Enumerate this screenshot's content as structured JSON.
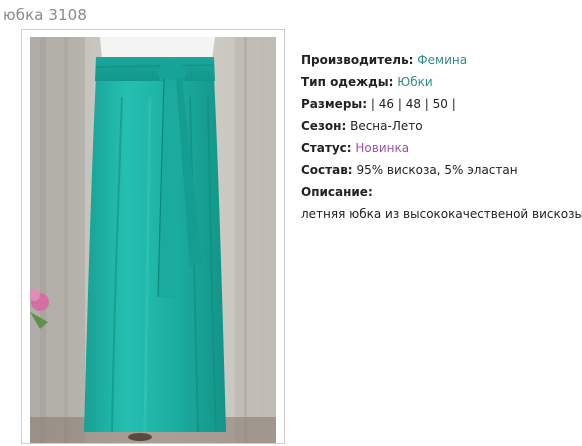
{
  "product": {
    "title": "юбка 3108",
    "image_alt": "turquoise maxi skirt with tie belt"
  },
  "details": {
    "manufacturer_label": "Производитель:",
    "manufacturer_value": "Фемина",
    "clothing_type_label": "Тип одежды:",
    "clothing_type_value": "Юбки",
    "sizes_label": "Размеры:",
    "sizes_value": "| 46 | 48 | 50 |",
    "season_label": "Сезон:",
    "season_value": "Весна-Лето",
    "status_label": "Статус:",
    "status_value": "Новинка",
    "composition_label": "Состав:",
    "composition_value": "95% вискоза, 5% эластан",
    "description_label": "Описание:",
    "description_value": "летняя юбка из высококачественой вискозы."
  },
  "colors": {
    "link_teal": "#2e8b8b",
    "status_purple": "#a04fb0",
    "skirt_turquoise": "#1fb3a6",
    "title_gray": "#8a8a8a"
  }
}
